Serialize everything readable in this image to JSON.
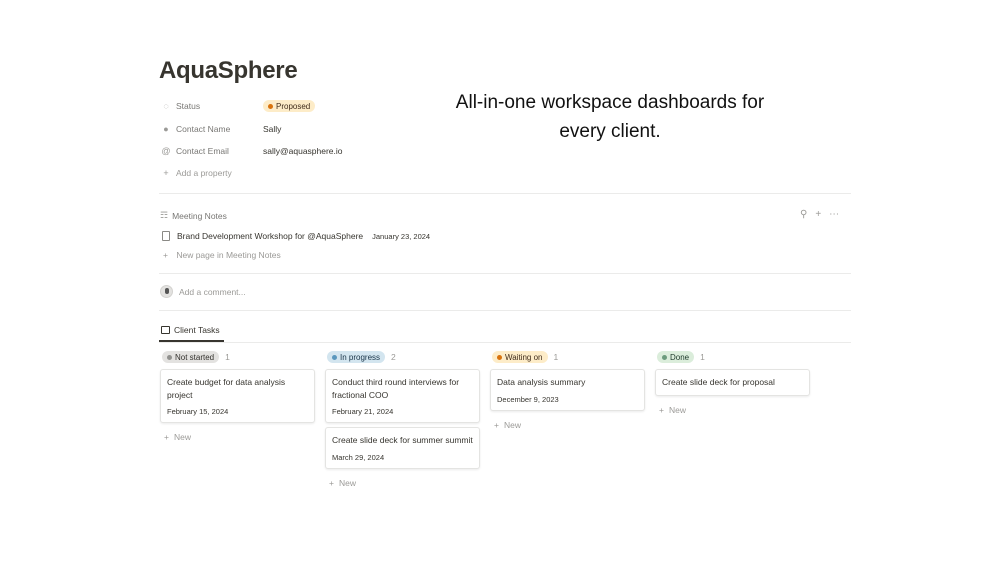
{
  "page": {
    "title": "AquaSphere"
  },
  "tagline": {
    "line1": "All-in-one workspace dashboards for",
    "line2": "every client."
  },
  "properties": {
    "status": {
      "name": "Status",
      "value": "Proposed",
      "color": "#fdecc8",
      "dot": "#d9730d",
      "icon": "status-icon"
    },
    "contact_name": {
      "name": "Contact Name",
      "value": "Sally",
      "icon": "person-icon"
    },
    "contact_email": {
      "name": "Contact Email",
      "value": "sally@aquasphere.io",
      "icon": "at-icon"
    },
    "add_property": "Add a property"
  },
  "meeting_notes": {
    "label": "Meeting Notes",
    "rows": [
      {
        "title": "Brand Development Workshop for @AquaSphere",
        "date": "January 23, 2024"
      }
    ],
    "new_page": "New page in Meeting Notes"
  },
  "comment": {
    "placeholder": "Add a comment..."
  },
  "client_tasks": {
    "tab_label": "Client Tasks",
    "new_label": "New",
    "columns": [
      {
        "status": "Not started",
        "count": "1",
        "bg": "#e3e2e0",
        "dot": "#91918e",
        "cards": [
          {
            "title": "Create budget for data analysis project",
            "date": "February 15, 2024"
          }
        ]
      },
      {
        "status": "In progress",
        "count": "2",
        "bg": "#d3e5ef",
        "dot": "#5b97bd",
        "cards": [
          {
            "title": "Conduct third round interviews for fractional COO",
            "date": "February 21, 2024"
          },
          {
            "title": "Create slide deck for summer summit",
            "date": "March 29, 2024"
          }
        ]
      },
      {
        "status": "Waiting on",
        "count": "1",
        "bg": "#fdecc8",
        "dot": "#d9730d",
        "cards": [
          {
            "title": "Data analysis summary",
            "date": "December 9, 2023"
          }
        ]
      },
      {
        "status": "Done",
        "count": "1",
        "bg": "#dbeddb",
        "dot": "#6c9b7d",
        "cards": [
          {
            "title": "Create slide deck for proposal",
            "date": ""
          }
        ]
      }
    ]
  }
}
